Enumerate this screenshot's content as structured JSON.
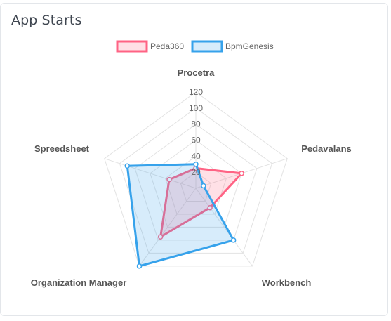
{
  "card": {
    "title": "App Starts"
  },
  "chart_data": {
    "type": "radar",
    "title": "",
    "axes": [
      "Procetra",
      "Pedavalans",
      "Workbench",
      "Organization Manager",
      "Spreedsheet"
    ],
    "r_ticks": [
      20,
      40,
      60,
      80,
      100,
      120
    ],
    "r_max": 120,
    "legend_position": "top",
    "series": [
      {
        "name": "Peda360",
        "values": [
          25,
          60,
          30,
          75,
          35
        ],
        "border_color": "#ff6384",
        "fill_color": "rgba(255,99,132,0.2)"
      },
      {
        "name": "BpmGenesis",
        "values": [
          30,
          10,
          80,
          120,
          90
        ],
        "border_color": "#36a2eb",
        "fill_color": "rgba(54,162,235,0.2)"
      }
    ]
  }
}
